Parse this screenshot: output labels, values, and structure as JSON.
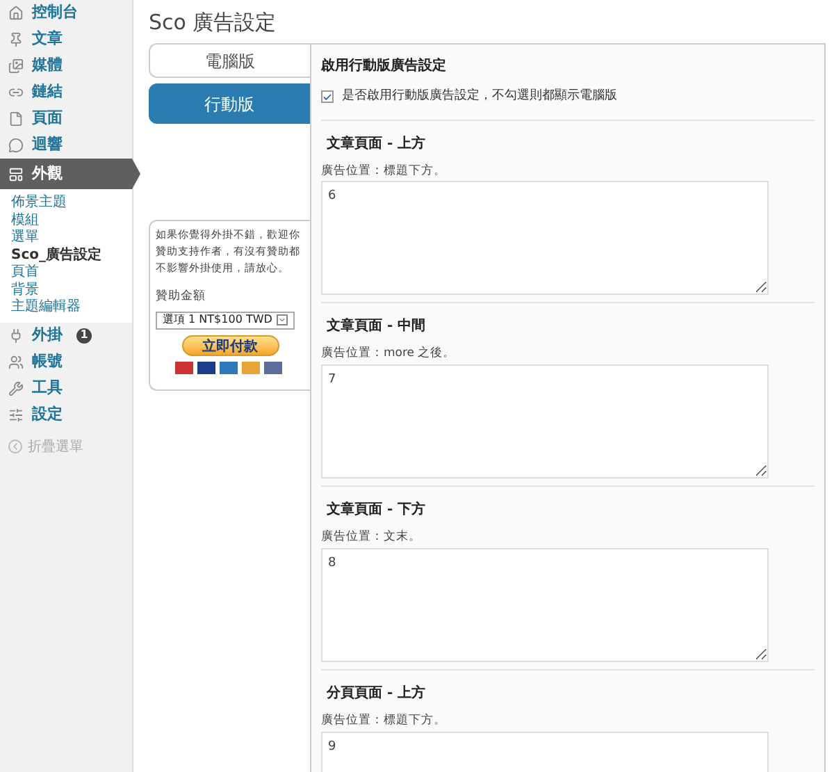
{
  "sidebar": {
    "items": [
      {
        "label": "控制台",
        "selected": false
      },
      {
        "label": "文章",
        "selected": false
      },
      {
        "label": "媒體",
        "selected": false
      },
      {
        "label": "鏈結",
        "selected": false
      },
      {
        "label": "頁面",
        "selected": false
      },
      {
        "label": "迴響",
        "selected": false
      },
      {
        "label": "外觀",
        "selected": true,
        "children": [
          {
            "label": "佈景主題",
            "selected": false
          },
          {
            "label": "模組",
            "selected": false
          },
          {
            "label": "選單",
            "selected": false
          },
          {
            "label": "Sco_廣告設定",
            "selected": true
          },
          {
            "label": "頁首",
            "selected": false
          },
          {
            "label": "背景",
            "selected": false
          },
          {
            "label": "主題編輯器",
            "selected": false
          }
        ]
      },
      {
        "label": "外掛",
        "selected": false,
        "badge": "1"
      },
      {
        "label": "帳號",
        "selected": false
      },
      {
        "label": "工具",
        "selected": false
      },
      {
        "label": "設定",
        "selected": false
      }
    ],
    "collapse": "折疊選單"
  },
  "page_title": "Sco 廣告設定",
  "tabs": [
    {
      "label": "電腦版",
      "selected": false
    },
    {
      "label": "行動版",
      "selected": true
    }
  ],
  "donate": {
    "text": "如果你覺得外掛不錯，歡迎你贊助支持作者，有沒有贊助都不影響外掛使用，請放心。",
    "amount_label": "贊助金額",
    "select_value": "選項 1 NT$100 TWD",
    "pay_button": "立即付款"
  },
  "panel": {
    "heading": "啟用行動版廣告設定",
    "checkbox": {
      "label": "是否啟用行動版廣告設定，不勾選則都顯示電腦版",
      "checked": true
    },
    "sections": [
      {
        "title": "文章頁面 - 上方",
        "hint": "廣告位置：標題下方。",
        "value": "6"
      },
      {
        "title": "文章頁面 - 中間",
        "hint": "廣告位置：more 之後。",
        "value": "7"
      },
      {
        "title": "文章頁面 - 下方",
        "hint": "廣告位置：文末。",
        "value": "8"
      },
      {
        "title": "分頁頁面 - 上方",
        "hint": "廣告位置：標題下方。",
        "value": "9"
      }
    ]
  }
}
